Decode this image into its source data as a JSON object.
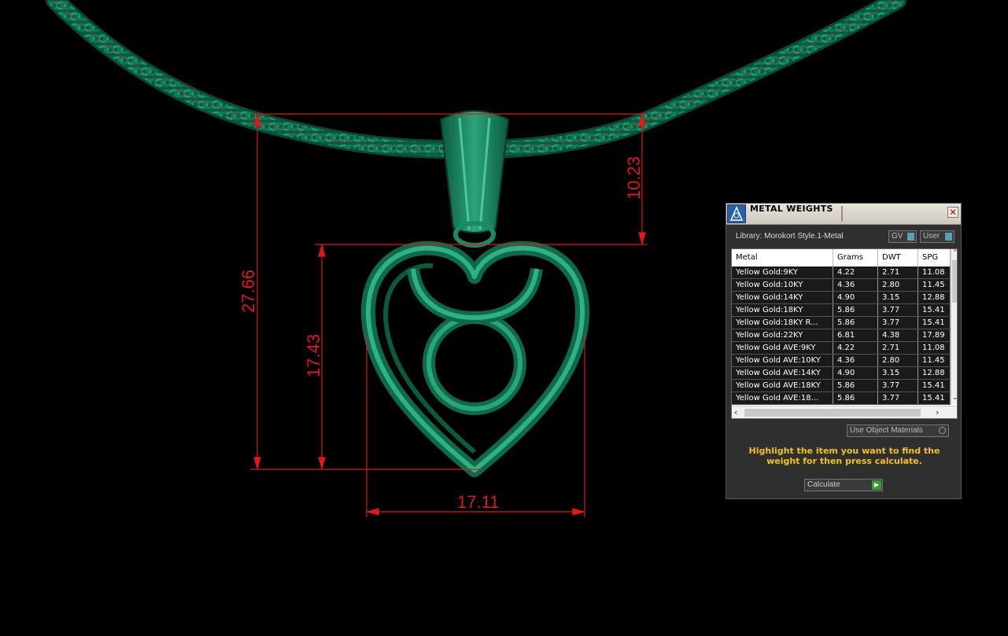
{
  "dimensions": {
    "total_height": "27.66",
    "heart_height": "17.43",
    "bail_height": "10.23",
    "width": "17.11"
  },
  "colors": {
    "model": "#0f6e4f",
    "dimension": "#e01818",
    "hint": "#f2c21a"
  },
  "panel": {
    "title": "METAL WEIGHTS",
    "library": "Library: Morokort Style.1-Metal",
    "toggle_gv": "GV",
    "toggle_user": "User",
    "columns": [
      "Metal",
      "Grams",
      "DWT",
      "SPG"
    ],
    "rows": [
      [
        "Yellow Gold:9KY",
        "4.22",
        "2.71",
        "11.08"
      ],
      [
        "Yellow Gold:10KY",
        "4.36",
        "2.80",
        "11.45"
      ],
      [
        "Yellow Gold:14KY",
        "4.90",
        "3.15",
        "12.88"
      ],
      [
        "Yellow Gold:18KY",
        "5.86",
        "3.77",
        "15.41"
      ],
      [
        "Yellow Gold:18KY R...",
        "5.86",
        "3.77",
        "15.41"
      ],
      [
        "Yellow Gold:22KY",
        "6.81",
        "4.38",
        "17.89"
      ],
      [
        "Yellow Gold AVE:9KY",
        "4.22",
        "2.71",
        "11.08"
      ],
      [
        "Yellow Gold AVE:10KY",
        "4.36",
        "2.80",
        "11.45"
      ],
      [
        "Yellow Gold AVE:14KY",
        "4.90",
        "3.15",
        "12.88"
      ],
      [
        "Yellow Gold AVE:18KY",
        "5.86",
        "3.77",
        "15.41"
      ],
      [
        "Yellow Gold AVE:18...",
        "5.86",
        "3.77",
        "15.41"
      ]
    ],
    "use_object_materials": "Use Object Materials",
    "hint": "Highlight the item you want to find the weight for then press calculate.",
    "calculate": "Calculate"
  }
}
